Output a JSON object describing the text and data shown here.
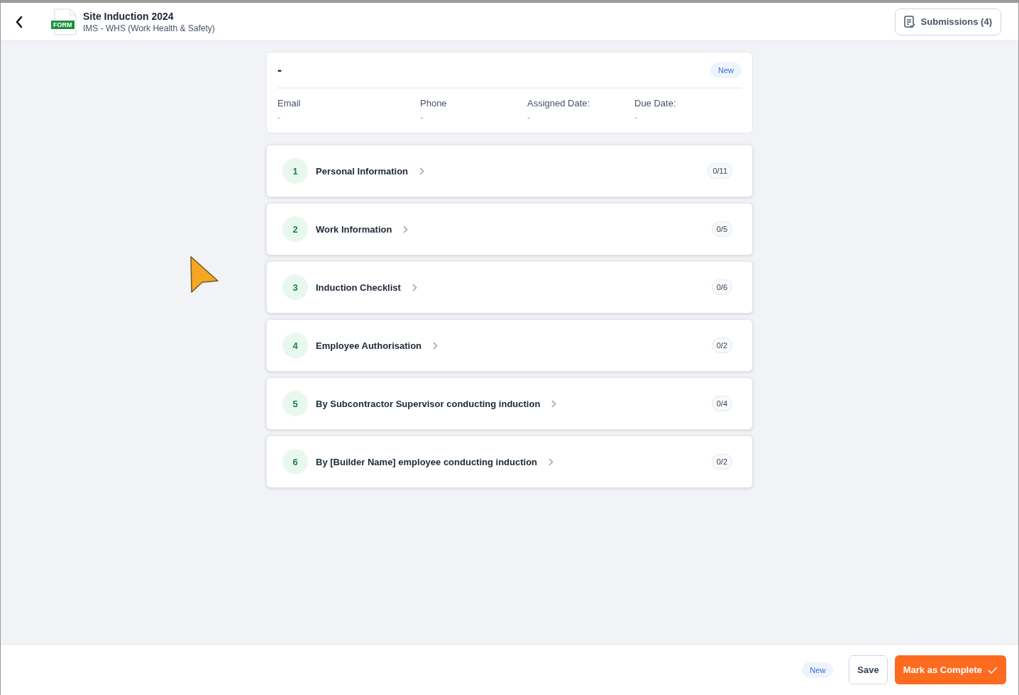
{
  "header": {
    "badge": "FORM",
    "title": "Site Induction 2024",
    "subtitle": "IMS - WHS (Work Health & Safety)",
    "submissions_button": "Submissions (4)"
  },
  "summary": {
    "name": "-",
    "status": "New",
    "fields": [
      {
        "label": "Email",
        "value": "-"
      },
      {
        "label": "Phone",
        "value": "-"
      },
      {
        "label": "Assigned Date:",
        "value": "-"
      },
      {
        "label": "Due Date:",
        "value": "-"
      }
    ]
  },
  "sections": [
    {
      "number": "1",
      "title": "Personal Information",
      "progress": "0/11"
    },
    {
      "number": "2",
      "title": "Work Information",
      "progress": "0/5"
    },
    {
      "number": "3",
      "title": "Induction Checklist",
      "progress": "0/6"
    },
    {
      "number": "4",
      "title": "Employee Authorisation",
      "progress": "0/2"
    },
    {
      "number": "5",
      "title": "By Subcontractor Supervisor conducting induction",
      "progress": "0/4"
    },
    {
      "number": "6",
      "title": "By [Builder Name] employee conducting induction",
      "progress": "0/2"
    }
  ],
  "footer": {
    "status": "New",
    "save_button": "Save",
    "complete_button": "Mark as Complete"
  }
}
